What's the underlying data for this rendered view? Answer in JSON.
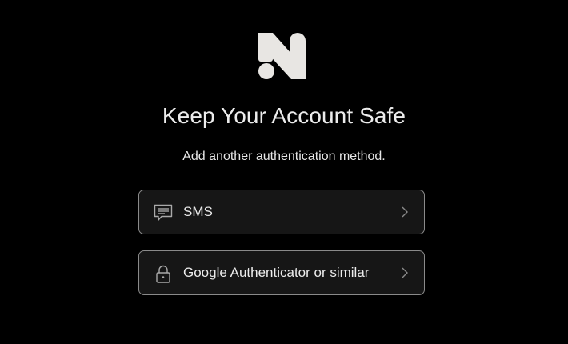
{
  "brand": {
    "logo_icon": "brand-n-logo-icon",
    "logo_color": "#e8e6e3"
  },
  "header": {
    "title": "Keep Your Account Safe",
    "subtitle": "Add another authentication method."
  },
  "options": [
    {
      "label": "SMS",
      "icon": "message-icon"
    },
    {
      "label": "Google Authenticator or similar",
      "icon": "lock-icon"
    }
  ],
  "colors": {
    "background": "#000000",
    "card_background": "#161616",
    "card_border": "#8a8a8a",
    "text": "#ececec",
    "icon": "#a9a9a9"
  }
}
